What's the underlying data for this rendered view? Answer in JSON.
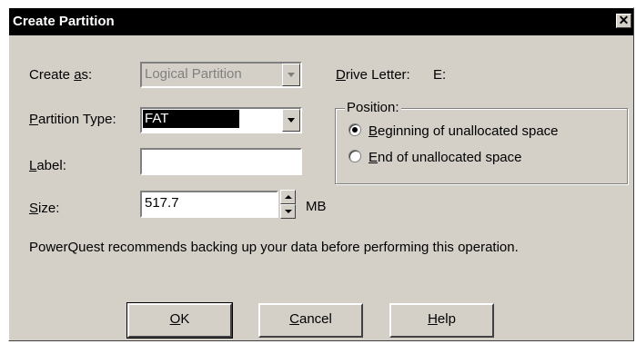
{
  "window": {
    "title": "Create Partition",
    "close_glyph": "✕"
  },
  "form": {
    "create_as_label_prefix": "Create ",
    "create_as_label_key": "a",
    "create_as_label_suffix": "s:",
    "create_as_value": "Logical Partition",
    "partition_type_label_key": "P",
    "partition_type_label_suffix": "artition Type:",
    "partition_type_value": "FAT",
    "label_label_key": "L",
    "label_label_suffix": "abel:",
    "label_value": "",
    "size_label_key": "S",
    "size_label_suffix": "ize:",
    "size_value": "517.7",
    "size_unit": "MB"
  },
  "drive": {
    "label_key": "D",
    "label_suffix": "rive Letter:",
    "value": "E:"
  },
  "position": {
    "legend": "Position:",
    "options": [
      {
        "key": "B",
        "label_suffix": "eginning of unallocated space",
        "checked": true
      },
      {
        "key": "E",
        "label_suffix": "nd of unallocated space",
        "checked": false
      }
    ]
  },
  "message": "PowerQuest recommends backing up your data before performing this operation.",
  "buttons": {
    "ok_key": "O",
    "ok_suffix": "K",
    "cancel_key": "C",
    "cancel_suffix": "ancel",
    "help_key": "H",
    "help_suffix": "elp"
  },
  "colors": {
    "titlebar": "#000000",
    "dialog_face": "#d4d0c8",
    "selection": "#000000"
  },
  "icons": {
    "close": "close-icon",
    "dropdown": "chevron-down-icon",
    "spin_up": "arrow-up-icon",
    "spin_down": "arrow-down-icon"
  }
}
